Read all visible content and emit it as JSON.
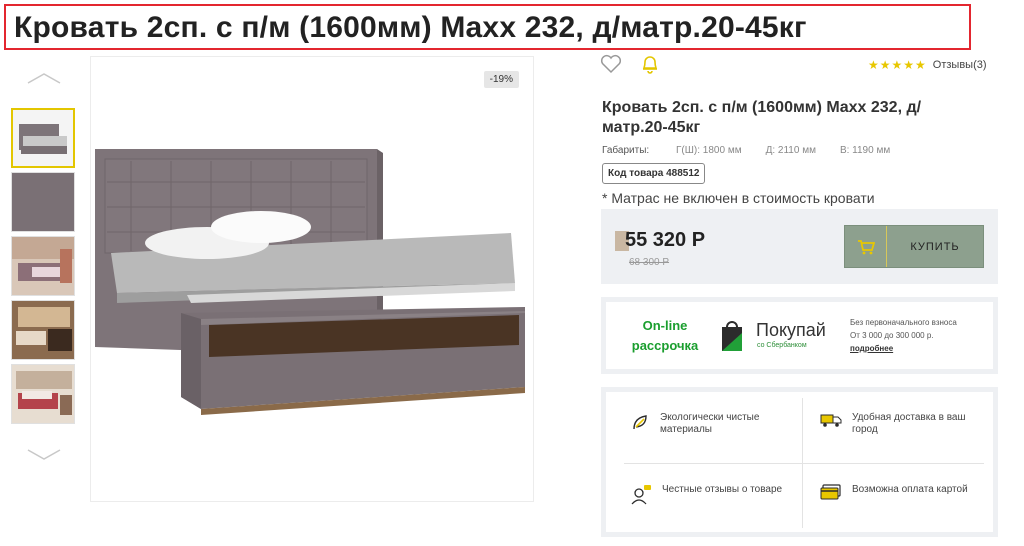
{
  "header": {
    "title": "Кровать 2сп. с п/м (1600мм) Maxx 232, д/матр.20-45кг"
  },
  "gallery": {
    "badge": "-19%",
    "thumbnails": [
      "bed-front",
      "fabric-swatch",
      "bedroom-1",
      "bedroom-2",
      "bedroom-3"
    ]
  },
  "product": {
    "name": "Кровать 2сп. с п/м (1600мм) Maxx 232, д/матр.20-45кг",
    "rating_stars": "★★★★★",
    "reviews": "Отзывы(3)",
    "dims_label": "Габариты:",
    "dim_w": "Г(Ш): 1800 мм",
    "dim_d": "Д: 2110 мм",
    "dim_h": "В: 1190 мм",
    "sku": "Код товара 488512",
    "note": "* Матрас не включен в стоимость кровати"
  },
  "price": {
    "current": "55 320 Р",
    "old": "68 300 Р",
    "buy_label": "КУПИТЬ"
  },
  "installment": {
    "title": "On-line рассрочка",
    "brand": "Покупай",
    "brand_sub": "со Сбербанком",
    "info_line1": "Без первоначального взноса",
    "info_line2": "От 3 000 до 300 000 р.",
    "info_link": "подробнее"
  },
  "features": [
    {
      "icon": "eco-leaf-icon",
      "text": "Экологически чистые материалы"
    },
    {
      "icon": "delivery-truck-icon",
      "text": "Удобная доставка в ваш город"
    },
    {
      "icon": "reviews-person-icon",
      "text": "Честные отзывы о товаре"
    },
    {
      "icon": "card-payment-icon",
      "text": "Возможна оплата картой"
    }
  ],
  "colors": {
    "accent_green": "#1a9e2e",
    "buy_button": "#8da08e",
    "star": "#e8c700",
    "title_border": "#e3262f"
  }
}
